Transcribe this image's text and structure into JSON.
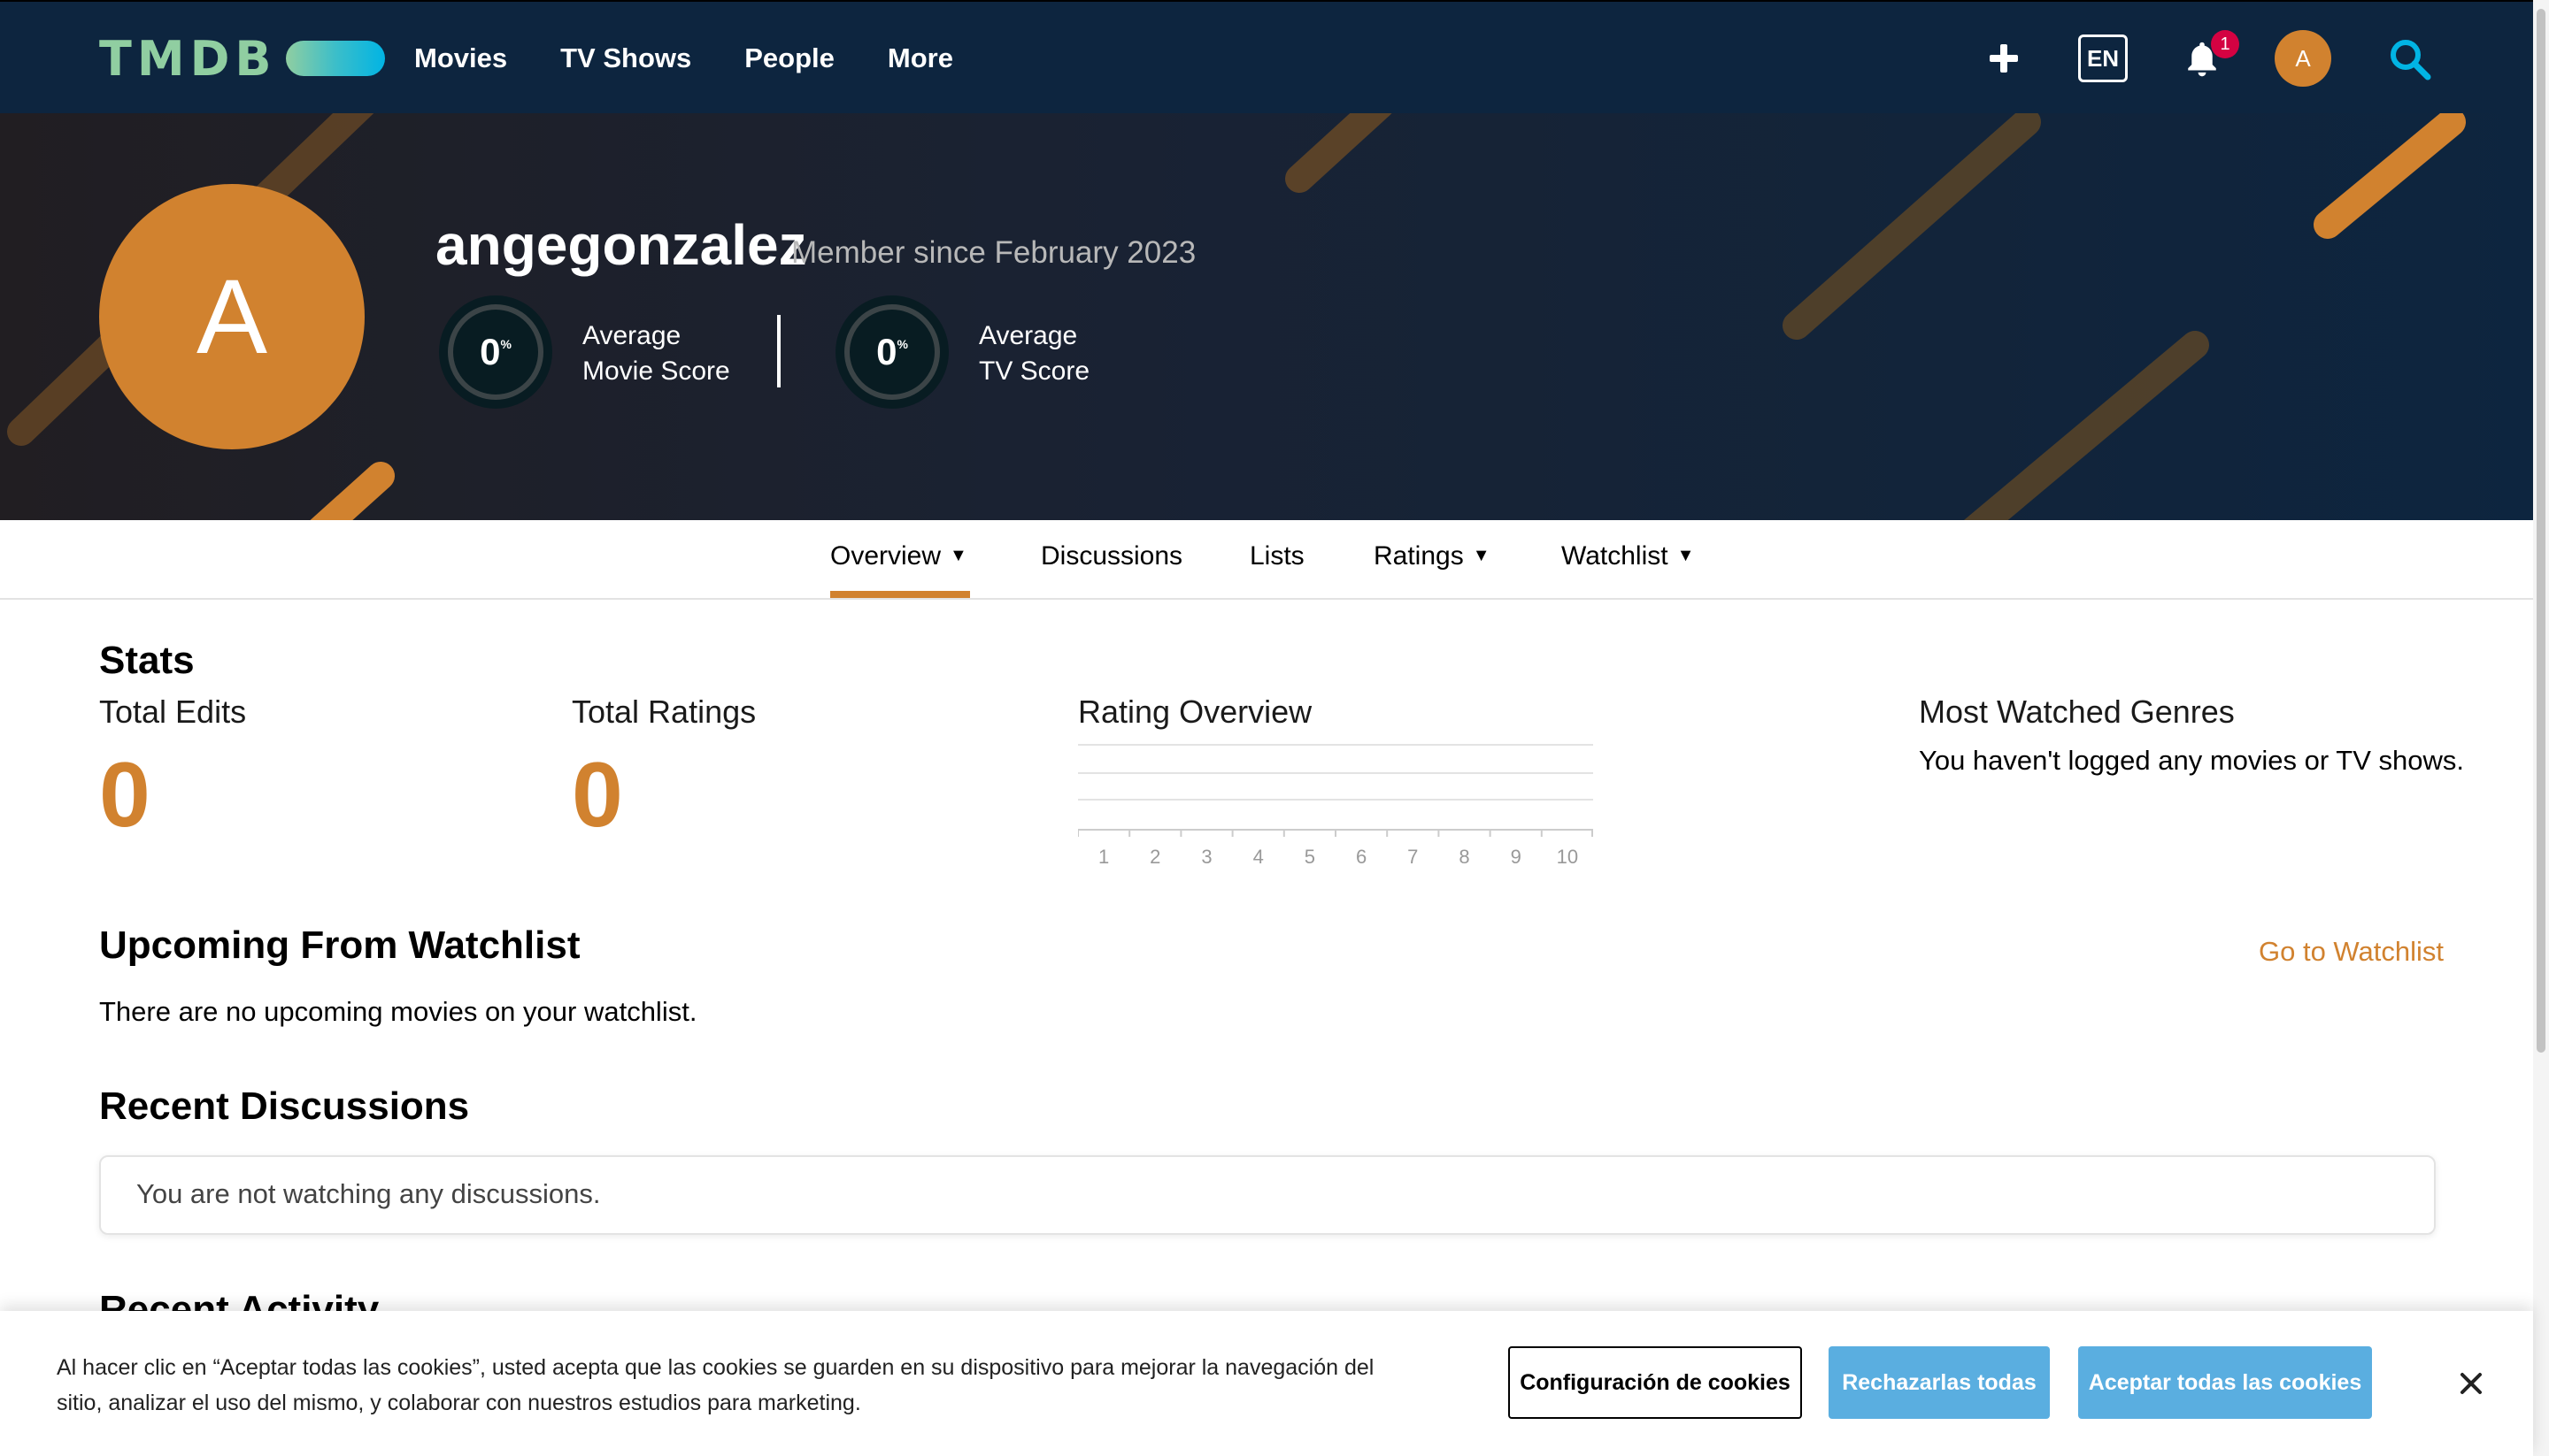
{
  "header": {
    "logo_text": "TMDB",
    "nav": [
      "Movies",
      "TV Shows",
      "People",
      "More"
    ],
    "language": "EN",
    "notifications_count": "1",
    "avatar_letter": "A"
  },
  "profile": {
    "avatar_letter": "A",
    "username": "angegonzalez",
    "member_since": "Member since February 2023",
    "movie_score": "0",
    "movie_score_label_1": "Average",
    "movie_score_label_2": "Movie Score",
    "tv_score": "0",
    "tv_score_label_1": "Average",
    "tv_score_label_2": "TV Score",
    "percent_symbol": "%"
  },
  "tabs": [
    {
      "label": "Overview",
      "has_dropdown": true,
      "active": true
    },
    {
      "label": "Discussions",
      "has_dropdown": false
    },
    {
      "label": "Lists",
      "has_dropdown": false
    },
    {
      "label": "Ratings",
      "has_dropdown": true
    },
    {
      "label": "Watchlist",
      "has_dropdown": true
    }
  ],
  "stats": {
    "heading": "Stats",
    "total_edits_label": "Total Edits",
    "total_edits": "0",
    "total_ratings_label": "Total Ratings",
    "total_ratings": "0",
    "rating_overview_label": "Rating Overview",
    "rating_axis": [
      "1",
      "2",
      "3",
      "4",
      "5",
      "6",
      "7",
      "8",
      "9",
      "10"
    ],
    "genres_label": "Most Watched Genres",
    "genres_empty": "You haven't logged any movies or TV shows."
  },
  "upcoming": {
    "heading": "Upcoming From Watchlist",
    "link": "Go to Watchlist",
    "empty": "There are no upcoming movies on your watchlist."
  },
  "discussions": {
    "heading": "Recent Discussions",
    "empty": "You are not watching any discussions."
  },
  "activity": {
    "heading": "Recent Activity"
  },
  "cookie": {
    "text": "Al hacer clic en “Aceptar todas las cookies”, usted acepta que las cookies se guarden en su dispositivo para mejorar la navegación del sitio, analizar el uso del mismo, y colaborar con nuestros estudios para marketing.",
    "config_label": "Configuración de cookies",
    "reject_label": "Rechazarlas todas",
    "accept_label": "Aceptar todas las cookies"
  },
  "colors": {
    "navy": "#0d253f",
    "accent_orange": "#d1822f",
    "cookie_blue": "#5aaee0",
    "logo_green": "#90cea1",
    "logo_blue": "#01b4e4"
  }
}
